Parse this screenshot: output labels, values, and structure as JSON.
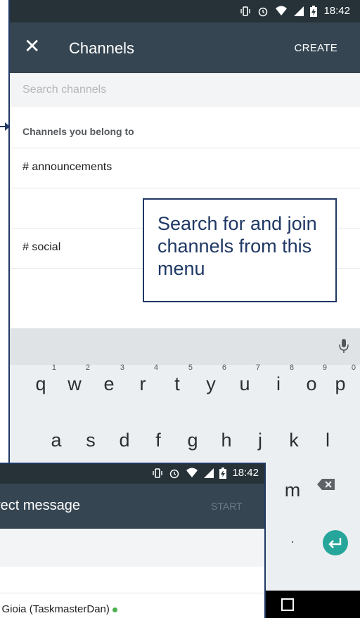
{
  "status": {
    "time": "18:42"
  },
  "appbar": {
    "title": "Channels",
    "close_icon": "close-icon",
    "create_label": "CREATE"
  },
  "search": {
    "placeholder": "Search channels",
    "value": ""
  },
  "section": {
    "title": "Channels you belong to"
  },
  "channels": [
    {
      "label": "# announcements"
    },
    {
      "label": ""
    },
    {
      "label": "# social"
    }
  ],
  "callout": {
    "text": "Search for and join channels from this menu"
  },
  "keyboard": {
    "row1": [
      "q",
      "w",
      "e",
      "r",
      "t",
      "y",
      "u",
      "i",
      "o",
      "p"
    ],
    "row1_hints": [
      "1",
      "2",
      "3",
      "4",
      "5",
      "6",
      "7",
      "8",
      "9",
      "0"
    ],
    "row2": [
      "a",
      "s",
      "d",
      "f",
      "g",
      "h",
      "j",
      "k",
      "l"
    ],
    "row3_visible": [
      "m"
    ],
    "row4_visible": [
      "."
    ]
  },
  "overlay": {
    "time": "18:42",
    "title": "rect message",
    "start_label": "START",
    "user": "n Gioia (TaskmasterDan)"
  },
  "colors": {
    "appbar": "#354551",
    "statusbar": "#263238",
    "callout_border": "#1f3864",
    "enter": "#26a69a"
  }
}
